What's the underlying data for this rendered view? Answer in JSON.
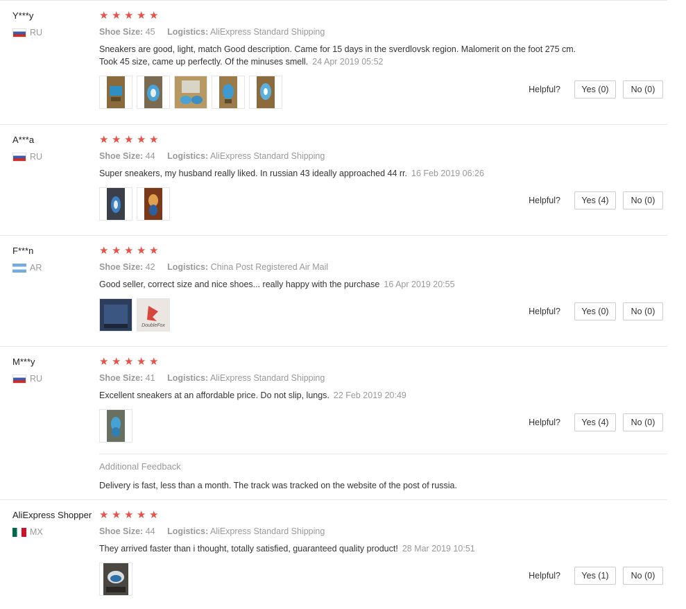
{
  "reviews": [
    {
      "user": "Y***y",
      "country": "RU",
      "rating": 5,
      "size_label": "Shoe Size:",
      "size": "45",
      "logistics_label": "Logistics:",
      "logistics": "AliExpress Standard Shipping",
      "text": "Sneakers are good, light, match Good description. Came for 15 days in the sverdlovsk region. Malomerit on the foot 275 cm. Took 45 size, came up perfectly. Of the minuses smell.",
      "date": "24 Apr 2019 05:52",
      "photos": 5,
      "helpful_label": "Helpful?",
      "yes": "Yes (0)",
      "no": "No (0)"
    },
    {
      "user": "A***a",
      "country": "RU",
      "rating": 5,
      "size_label": "Shoe Size:",
      "size": "44",
      "logistics_label": "Logistics:",
      "logistics": "AliExpress Standard Shipping",
      "text": "Super sneakers, my husband really liked. In russian 43 ideally approached 44 rr.",
      "date": "16 Feb 2019 06:26",
      "photos": 2,
      "helpful_label": "Helpful?",
      "yes": "Yes (4)",
      "no": "No (0)"
    },
    {
      "user": "F***n",
      "country": "AR",
      "rating": 5,
      "size_label": "Shoe Size:",
      "size": "42",
      "logistics_label": "Logistics:",
      "logistics": "China Post Registered Air Mail",
      "text": "Good seller, correct size and nice shoes... really happy with the purchase",
      "date": "16 Apr 2019 20:55",
      "photos": 2,
      "photo_caption": "DoubleFox",
      "helpful_label": "Helpful?",
      "yes": "Yes (0)",
      "no": "No (0)"
    },
    {
      "user": "M***y",
      "country": "RU",
      "rating": 5,
      "size_label": "Shoe Size:",
      "size": "41",
      "logistics_label": "Logistics:",
      "logistics": "AliExpress Standard Shipping",
      "text": "Excellent sneakers at an affordable price. Do not slip, lungs.",
      "date": "22 Feb 2019 20:49",
      "photos": 1,
      "helpful_label": "Helpful?",
      "yes": "Yes (4)",
      "no": "No (0)",
      "additional_title": "Additional Feedback",
      "additional_text": "Delivery is fast, less than a month. The track was tracked on the website of the post of russia."
    },
    {
      "user": "AliExpress Shopper",
      "country": "MX",
      "rating": 5,
      "size_label": "Shoe Size:",
      "size": "44",
      "logistics_label": "Logistics:",
      "logistics": "AliExpress Standard Shipping",
      "text": "They arrived faster than i thought, totally satisfied, guaranteed quality product!",
      "date": "28 Mar 2019 10:51",
      "photos": 1,
      "helpful_label": "Helpful?",
      "yes": "Yes (1)",
      "no": "No (0)"
    }
  ],
  "colors": {
    "star": "#e8514a",
    "muted": "#999999",
    "text": "#333333",
    "border": "#e8e8e8"
  },
  "icons": {
    "star": "star-icon",
    "photo": "photo-thumbnail"
  }
}
